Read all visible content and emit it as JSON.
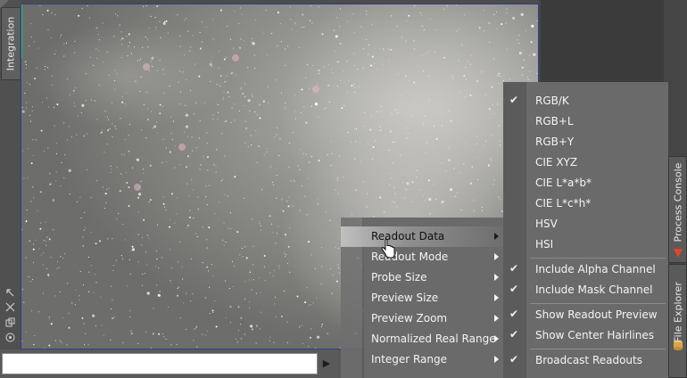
{
  "left_panel": {
    "tab_label": "Integration",
    "icons": [
      "cursor-arrow-icon",
      "crosshair-icon",
      "copy-icon",
      "target-icon"
    ]
  },
  "bottom_bar": {
    "field_value": "",
    "play_icon": "▶"
  },
  "right_panel": {
    "tabs": [
      {
        "label": "Process Console",
        "icon": "process-console-icon",
        "icon_color": "#e0452a"
      },
      {
        "label": "File Explorer",
        "icon": "file-explorer-icon",
        "icon_color": "#d7a64a"
      }
    ]
  },
  "context_menu": {
    "items": [
      {
        "label": "Readout Data",
        "has_submenu": true,
        "selected": true
      },
      {
        "label": "Readout Mode",
        "has_submenu": true
      },
      {
        "label": "Probe Size",
        "has_submenu": true
      },
      {
        "label": "Preview Size",
        "has_submenu": true
      },
      {
        "label": "Preview Zoom",
        "has_submenu": true
      },
      {
        "label": "Normalized Real Range",
        "has_submenu": true
      },
      {
        "label": "Integer Range",
        "has_submenu": true
      }
    ]
  },
  "submenu": {
    "groups": [
      [
        {
          "label": "RGB/K",
          "checked": true
        },
        {
          "label": "RGB+L",
          "checked": false
        },
        {
          "label": "RGB+Y",
          "checked": false
        },
        {
          "label": "CIE XYZ",
          "checked": false
        },
        {
          "label": "CIE L*a*b*",
          "checked": false
        },
        {
          "label": "CIE L*c*h*",
          "checked": false
        },
        {
          "label": "HSV",
          "checked": false
        },
        {
          "label": "HSI",
          "checked": false
        }
      ],
      [
        {
          "label": "Include Alpha Channel",
          "checked": true
        },
        {
          "label": "Include Mask Channel",
          "checked": true
        }
      ],
      [
        {
          "label": "Show Readout Preview",
          "checked": true
        },
        {
          "label": "Show Center Hairlines",
          "checked": true
        }
      ],
      [
        {
          "label": "Broadcast Readouts",
          "checked": true
        }
      ]
    ],
    "check_glyph": "✔"
  },
  "colors": {
    "viewport_border": "#2f3f8f",
    "menu_bg": "#6a6a6a",
    "selection_highlight": "#c8c8c8"
  }
}
